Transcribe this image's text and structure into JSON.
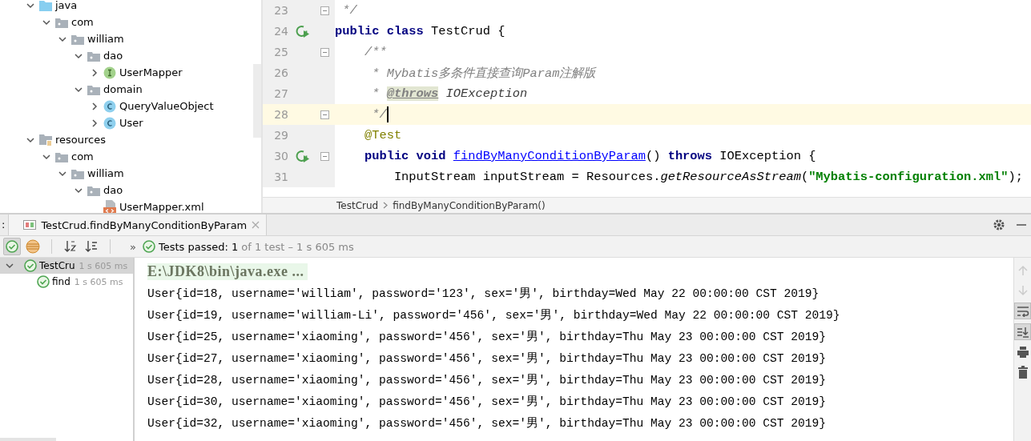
{
  "project_tree": [
    {
      "label": "java",
      "kind": "source-folder",
      "expanded": true,
      "children": [
        {
          "label": "com",
          "kind": "package",
          "expanded": true,
          "children": [
            {
              "label": "william",
              "kind": "package",
              "expanded": true,
              "children": [
                {
                  "label": "dao",
                  "kind": "package",
                  "expanded": true,
                  "children": [
                    {
                      "label": "UserMapper",
                      "kind": "interface",
                      "expanded": false
                    }
                  ]
                },
                {
                  "label": "domain",
                  "kind": "package",
                  "expanded": true,
                  "children": [
                    {
                      "label": "QueryValueObject",
                      "kind": "class",
                      "expanded": false
                    },
                    {
                      "label": "User",
                      "kind": "class",
                      "expanded": false
                    }
                  ]
                }
              ]
            }
          ]
        }
      ]
    },
    {
      "label": "resources",
      "kind": "resource-folder",
      "expanded": true,
      "children": [
        {
          "label": "com",
          "kind": "package",
          "expanded": true,
          "children": [
            {
              "label": "william",
              "kind": "package",
              "expanded": true,
              "children": [
                {
                  "label": "dao",
                  "kind": "package",
                  "expanded": true,
                  "children": [
                    {
                      "label": "UserMapper.xml",
                      "kind": "xml"
                    }
                  ]
                }
              ]
            }
          ]
        }
      ]
    }
  ],
  "editor": {
    "lines": [
      {
        "number": "23",
        "fold": true,
        "run": false,
        "current": false,
        "tokens": [
          {
            "kind": "comment",
            "text": " */"
          }
        ]
      },
      {
        "number": "24",
        "fold": false,
        "run": true,
        "current": false,
        "tokens": [
          {
            "kind": "keyword",
            "text": "public class "
          },
          {
            "kind": "plain",
            "text": "TestCrud {"
          }
        ]
      },
      {
        "number": "25",
        "fold": true,
        "run": false,
        "current": false,
        "tokens": [
          {
            "kind": "comment",
            "text": "    /**"
          }
        ]
      },
      {
        "number": "26",
        "fold": false,
        "run": false,
        "current": false,
        "tokens": [
          {
            "kind": "comment",
            "text": "     * Mybatis多条件直接查询Param注解版"
          }
        ]
      },
      {
        "number": "27",
        "fold": false,
        "run": false,
        "current": false,
        "tokens": [
          {
            "kind": "comment",
            "text": "     * "
          },
          {
            "kind": "doctag",
            "text": "@throws"
          },
          {
            "kind": "docref",
            "text": " IOException"
          }
        ]
      },
      {
        "number": "28",
        "fold": true,
        "run": false,
        "current": true,
        "tokens": [
          {
            "kind": "comment",
            "text": "     */"
          }
        ]
      },
      {
        "number": "29",
        "fold": false,
        "run": false,
        "current": false,
        "tokens": [
          {
            "kind": "annotation",
            "text": "    @Test"
          }
        ]
      },
      {
        "number": "30",
        "fold": true,
        "run": true,
        "current": false,
        "tokens": [
          {
            "kind": "keyword",
            "text": "    public void "
          },
          {
            "kind": "method-link",
            "text": "findByManyConditionByParam"
          },
          {
            "kind": "plain",
            "text": "() "
          },
          {
            "kind": "keyword",
            "text": "throws "
          },
          {
            "kind": "plain",
            "text": "IOException {"
          }
        ]
      },
      {
        "number": "31",
        "fold": false,
        "run": false,
        "current": false,
        "tokens": [
          {
            "kind": "plain",
            "text": "        InputStream inputStream = Resources."
          },
          {
            "kind": "static",
            "text": "getResourceAsStream"
          },
          {
            "kind": "plain",
            "text": "("
          },
          {
            "kind": "string",
            "text": "\"Mybatis-configuration.xml\""
          },
          {
            "kind": "plain",
            "text": ");"
          }
        ]
      }
    ],
    "breadcrumbs": [
      "TestCrud",
      "findByManyConditionByParam()"
    ]
  },
  "run_panel": {
    "edge_text": ":",
    "tab": {
      "label": "TestCrud.findByManyConditionByParam",
      "selected": true
    },
    "toolbar": [
      {
        "kind": "show-passed",
        "on": true
      },
      {
        "kind": "show-ignored",
        "on": false
      },
      {
        "kind": "sort-alpha",
        "on": false
      },
      {
        "kind": "sort-duration",
        "on": false
      }
    ],
    "more": "»",
    "status": "Tests passed: 1",
    "status_detail": "of 1 test – 1 s 605 ms",
    "tests": [
      {
        "label": "TestCru",
        "time": "1 s 605 ms",
        "selected": true,
        "expanded": true,
        "children": [
          {
            "label": "find",
            "time": "1 s 605 ms",
            "selected": false
          }
        ]
      }
    ],
    "console": [
      {
        "kind": "command",
        "text": "E:\\JDK8\\bin\\java.exe ..."
      },
      {
        "kind": "output",
        "text": "User{id=18, username='william', password='123', sex='男', birthday=Wed May 22 00:00:00 CST 2019}"
      },
      {
        "kind": "output",
        "text": "User{id=19, username='william-Li', password='456', sex='男', birthday=Wed May 22 00:00:00 CST 2019}"
      },
      {
        "kind": "output",
        "text": "User{id=25, username='xiaoming', password='456', sex='男', birthday=Thu May 23 00:00:00 CST 2019}"
      },
      {
        "kind": "output",
        "text": "User{id=27, username='xiaoming', password='456', sex='男', birthday=Thu May 23 00:00:00 CST 2019}"
      },
      {
        "kind": "output",
        "text": "User{id=28, username='xiaoming', password='456', sex='男', birthday=Thu May 23 00:00:00 CST 2019}"
      },
      {
        "kind": "output",
        "text": "User{id=30, username='xiaoming', password='456', sex='男', birthday=Thu May 23 00:00:00 CST 2019}"
      },
      {
        "kind": "output",
        "text": "User{id=32, username='xiaoming', password='456', sex='男', birthday=Thu May 23 00:00:00 CST 2019}"
      }
    ],
    "side_tools": [
      {
        "kind": "up",
        "disabled": true,
        "on": false
      },
      {
        "kind": "down",
        "disabled": true,
        "on": false
      },
      {
        "kind": "wrap",
        "disabled": false,
        "on": true
      },
      {
        "kind": "scroll-end",
        "disabled": false,
        "on": true
      },
      {
        "kind": "print",
        "disabled": false,
        "on": false
      },
      {
        "kind": "clear",
        "disabled": false,
        "on": false
      }
    ]
  }
}
